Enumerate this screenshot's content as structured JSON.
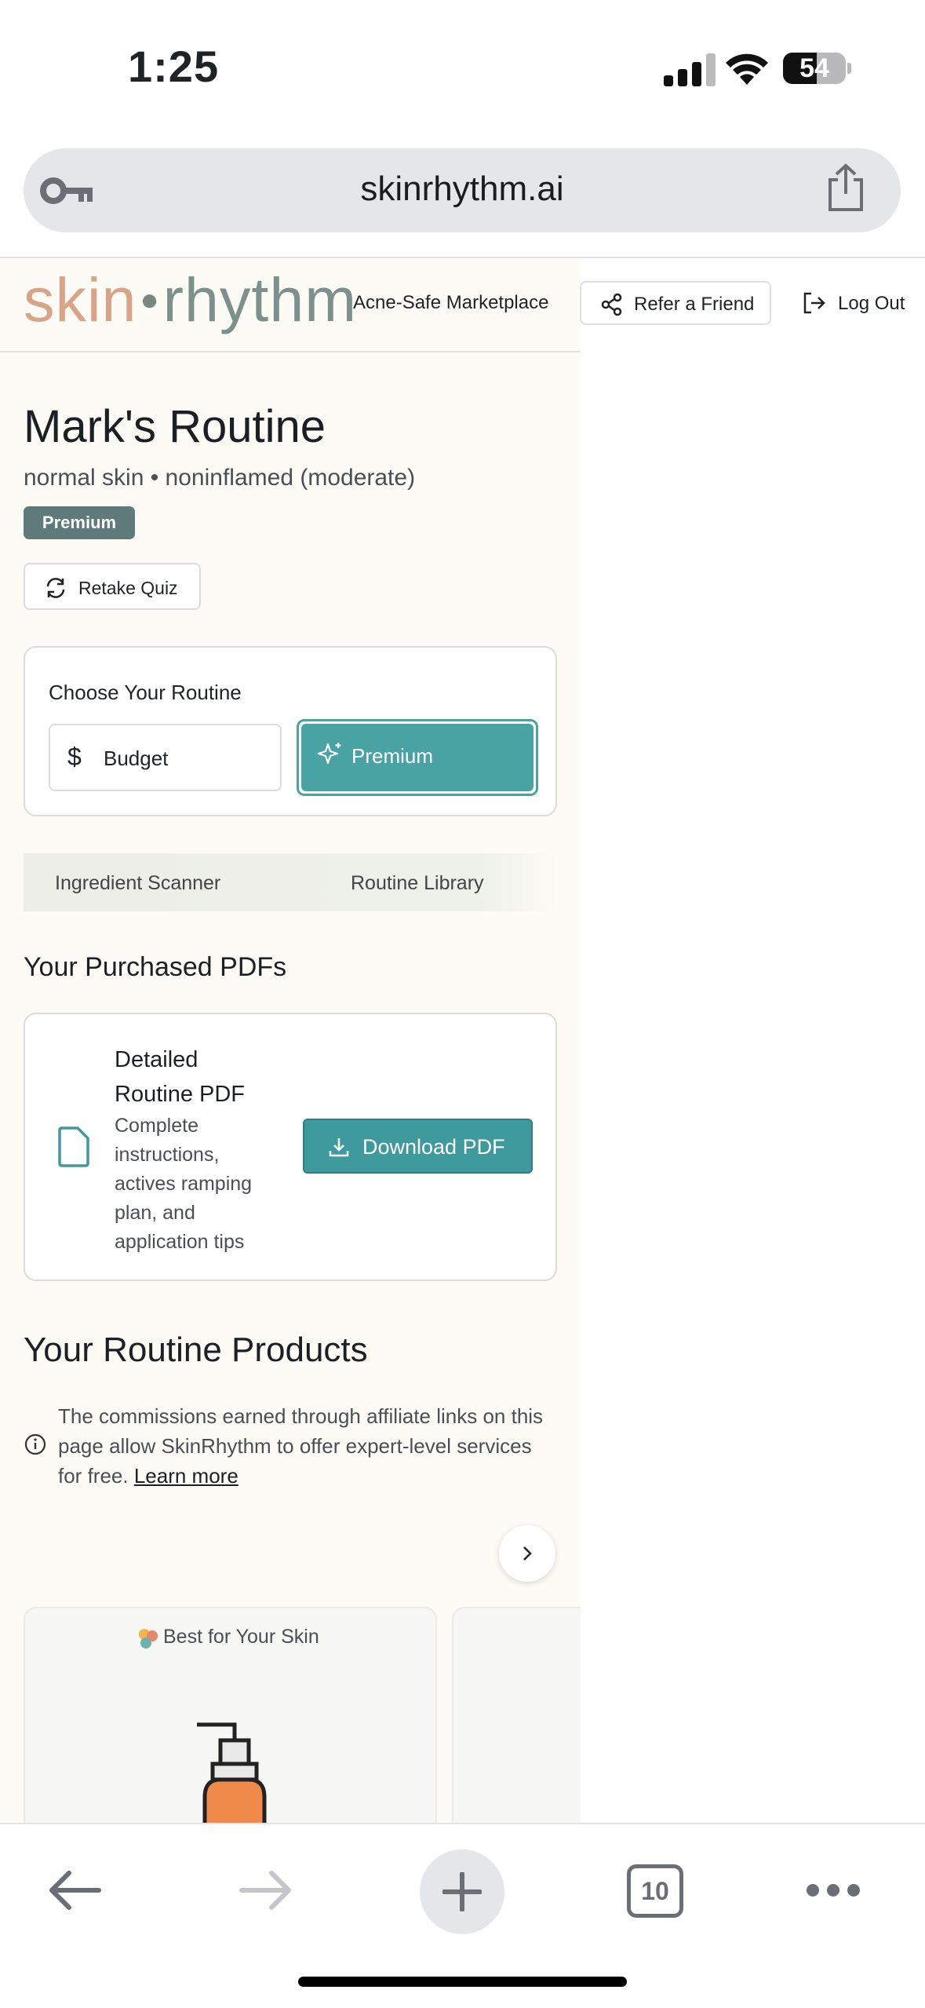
{
  "status_bar": {
    "time": "1:25",
    "battery": "54"
  },
  "browser": {
    "url": "skinrhythm.ai",
    "tab_count": "10"
  },
  "header": {
    "logo_left": "skin",
    "logo_right": "rhythm",
    "nav_marketplace": "Acne-Safe Marketplace",
    "refer_label": "Refer a Friend",
    "logout_label": "Log Out"
  },
  "routine": {
    "title": "Mark's Routine",
    "subtitle": "normal skin • noninflamed (moderate)",
    "badge": "Premium",
    "retake_label": "Retake Quiz"
  },
  "choose": {
    "heading": "Choose Your Routine",
    "options": [
      {
        "label": "Budget",
        "selected": false
      },
      {
        "label": "Premium",
        "selected": true
      }
    ]
  },
  "tabs": [
    "Ingredient Scanner",
    "Routine Library"
  ],
  "pdfs": {
    "heading": "Your Purchased PDFs",
    "items": [
      {
        "title": "Detailed Routine PDF",
        "description": "Complete instructions, actives ramping plan, and application tips",
        "button": "Download PDF"
      }
    ]
  },
  "products": {
    "heading": "Your Routine Products",
    "disclosure": "The commissions earned through affiliate links on this page allow SkinRhythm to offer expert-level services for free.",
    "learn_more": "Learn more",
    "cards": [
      {
        "tag": "Best for Your Skin"
      }
    ]
  },
  "colors": {
    "accent": "#4aa3a3",
    "badge": "#5e7a7a",
    "page_bg": "#fdfbf5",
    "logo_skin": "#d9a386",
    "logo_rhythm": "#7c918b"
  }
}
